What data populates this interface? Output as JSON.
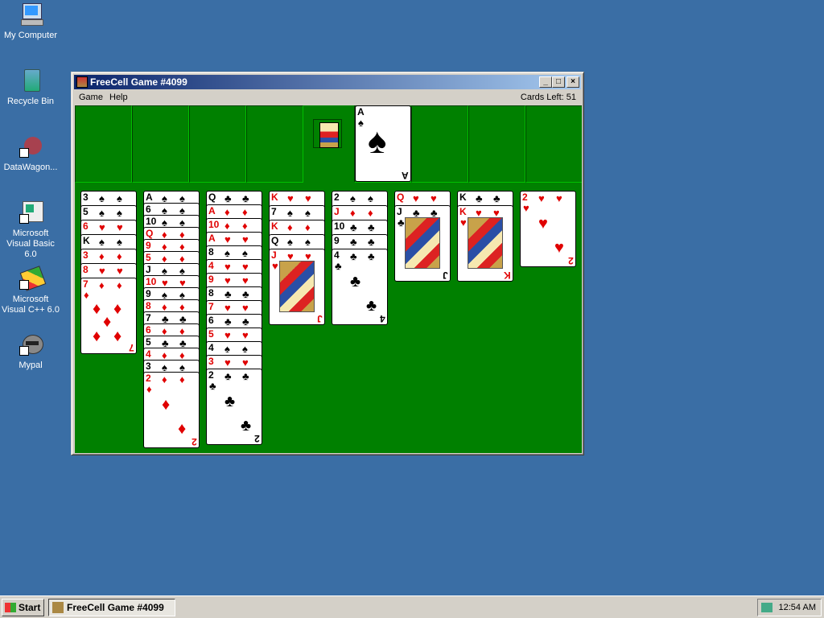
{
  "desktop": {
    "icons": [
      {
        "label": "My Computer"
      },
      {
        "label": "Recycle Bin"
      },
      {
        "label": "DataWagon..."
      },
      {
        "label": "Microsoft Visual Basic 6.0"
      },
      {
        "label": "Microsoft Visual C++ 6.0"
      },
      {
        "label": "Mypal"
      }
    ]
  },
  "window": {
    "title": "FreeCell Game #4099",
    "menu": {
      "game": "Game",
      "help": "Help"
    },
    "cards_left": "Cards Left: 51",
    "buttons": {
      "minimize": "_",
      "maximize": "□",
      "close": "×"
    }
  },
  "game": {
    "foundation_top": {
      "rank": "A",
      "suit": "♠"
    },
    "columns": [
      [
        {
          "r": "3",
          "s": "♠",
          "c": "black"
        },
        {
          "r": "5",
          "s": "♠",
          "c": "black"
        },
        {
          "r": "6",
          "s": "♥",
          "c": "red"
        },
        {
          "r": "K",
          "s": "♠",
          "c": "black"
        },
        {
          "r": "3",
          "s": "♦",
          "c": "red"
        },
        {
          "r": "8",
          "s": "♥",
          "c": "red"
        },
        {
          "r": "7",
          "s": "♦",
          "c": "red"
        }
      ],
      [
        {
          "r": "A",
          "s": "♠",
          "c": "black"
        },
        {
          "r": "6",
          "s": "♠",
          "c": "black"
        },
        {
          "r": "10",
          "s": "♠",
          "c": "black"
        },
        {
          "r": "Q",
          "s": "♦",
          "c": "red"
        },
        {
          "r": "9",
          "s": "♦",
          "c": "red"
        },
        {
          "r": "5",
          "s": "♦",
          "c": "red"
        },
        {
          "r": "J",
          "s": "♠",
          "c": "black"
        },
        {
          "r": "10",
          "s": "♥",
          "c": "red"
        },
        {
          "r": "9",
          "s": "♠",
          "c": "black"
        },
        {
          "r": "8",
          "s": "♦",
          "c": "red"
        },
        {
          "r": "7",
          "s": "♣",
          "c": "black"
        },
        {
          "r": "6",
          "s": "♦",
          "c": "red"
        },
        {
          "r": "5",
          "s": "♣",
          "c": "black"
        },
        {
          "r": "4",
          "s": "♦",
          "c": "red"
        },
        {
          "r": "3",
          "s": "♠",
          "c": "black"
        },
        {
          "r": "2",
          "s": "♦",
          "c": "red"
        }
      ],
      [
        {
          "r": "Q",
          "s": "♣",
          "c": "black"
        },
        {
          "r": "A",
          "s": "♦",
          "c": "red"
        },
        {
          "r": "10",
          "s": "♦",
          "c": "red"
        },
        {
          "r": "A",
          "s": "♥",
          "c": "red"
        },
        {
          "r": "8",
          "s": "♠",
          "c": "black"
        },
        {
          "r": "4",
          "s": "♥",
          "c": "red"
        },
        {
          "r": "9",
          "s": "♥",
          "c": "red"
        },
        {
          "r": "8",
          "s": "♣",
          "c": "black"
        },
        {
          "r": "7",
          "s": "♥",
          "c": "red"
        },
        {
          "r": "6",
          "s": "♣",
          "c": "black"
        },
        {
          "r": "5",
          "s": "♥",
          "c": "red"
        },
        {
          "r": "4",
          "s": "♠",
          "c": "black"
        },
        {
          "r": "3",
          "s": "♥",
          "c": "red"
        },
        {
          "r": "2",
          "s": "♣",
          "c": "black"
        }
      ],
      [
        {
          "r": "K",
          "s": "♥",
          "c": "red"
        },
        {
          "r": "7",
          "s": "♠",
          "c": "black"
        },
        {
          "r": "K",
          "s": "♦",
          "c": "red"
        },
        {
          "r": "Q",
          "s": "♠",
          "c": "black"
        },
        {
          "r": "J",
          "s": "♥",
          "c": "red"
        }
      ],
      [
        {
          "r": "2",
          "s": "♠",
          "c": "black"
        },
        {
          "r": "J",
          "s": "♦",
          "c": "red"
        },
        {
          "r": "10",
          "s": "♣",
          "c": "black"
        },
        {
          "r": "9",
          "s": "♣",
          "c": "black"
        },
        {
          "r": "4",
          "s": "♣",
          "c": "black"
        }
      ],
      [
        {
          "r": "Q",
          "s": "♥",
          "c": "red"
        },
        {
          "r": "J",
          "s": "♣",
          "c": "black"
        }
      ],
      [
        {
          "r": "K",
          "s": "♣",
          "c": "black"
        },
        {
          "r": "K",
          "s": "♥",
          "c": "red"
        }
      ],
      [
        {
          "r": "2",
          "s": "♥",
          "c": "red"
        }
      ]
    ]
  },
  "taskbar": {
    "start_label": "Start",
    "task_label": "FreeCell Game #4099",
    "clock": "12:54 AM"
  }
}
